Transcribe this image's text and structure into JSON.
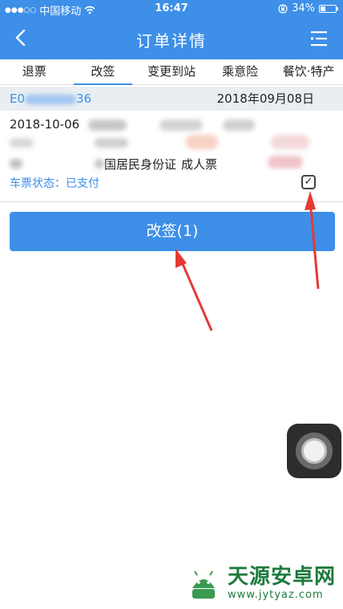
{
  "status_bar": {
    "signal_dots": "●●●○○",
    "carrier": "中国移动",
    "time": "16:47",
    "battery_percent": "34%",
    "battery_level": 0.34
  },
  "nav": {
    "title": "订单详情",
    "back_icon": "chevron-left-icon",
    "menu_icon": "list-menu-icon"
  },
  "tabs": [
    {
      "label": "退票"
    },
    {
      "label": "改签"
    },
    {
      "label": "变更到站"
    },
    {
      "label": "乘意险"
    },
    {
      "label": "餐饮·特产"
    }
  ],
  "order": {
    "number_prefix": "E0",
    "number_suffix": "36",
    "date": "2018年09月08日"
  },
  "ticket": {
    "depart_date": "2018-10-06",
    "id_type": "国居民身份证",
    "ticket_type": "成人票",
    "status_label": "车票状态：",
    "status_value": "已支付",
    "check_mark": "✓"
  },
  "change_button": {
    "label": "改签(1)"
  },
  "watermark": {
    "name": "天源安卓网",
    "url": "www.jytyaz.com"
  },
  "colors": {
    "primary": "#3d8fe8",
    "arrow": "#e53935",
    "watermark": "#1e7a3c"
  }
}
